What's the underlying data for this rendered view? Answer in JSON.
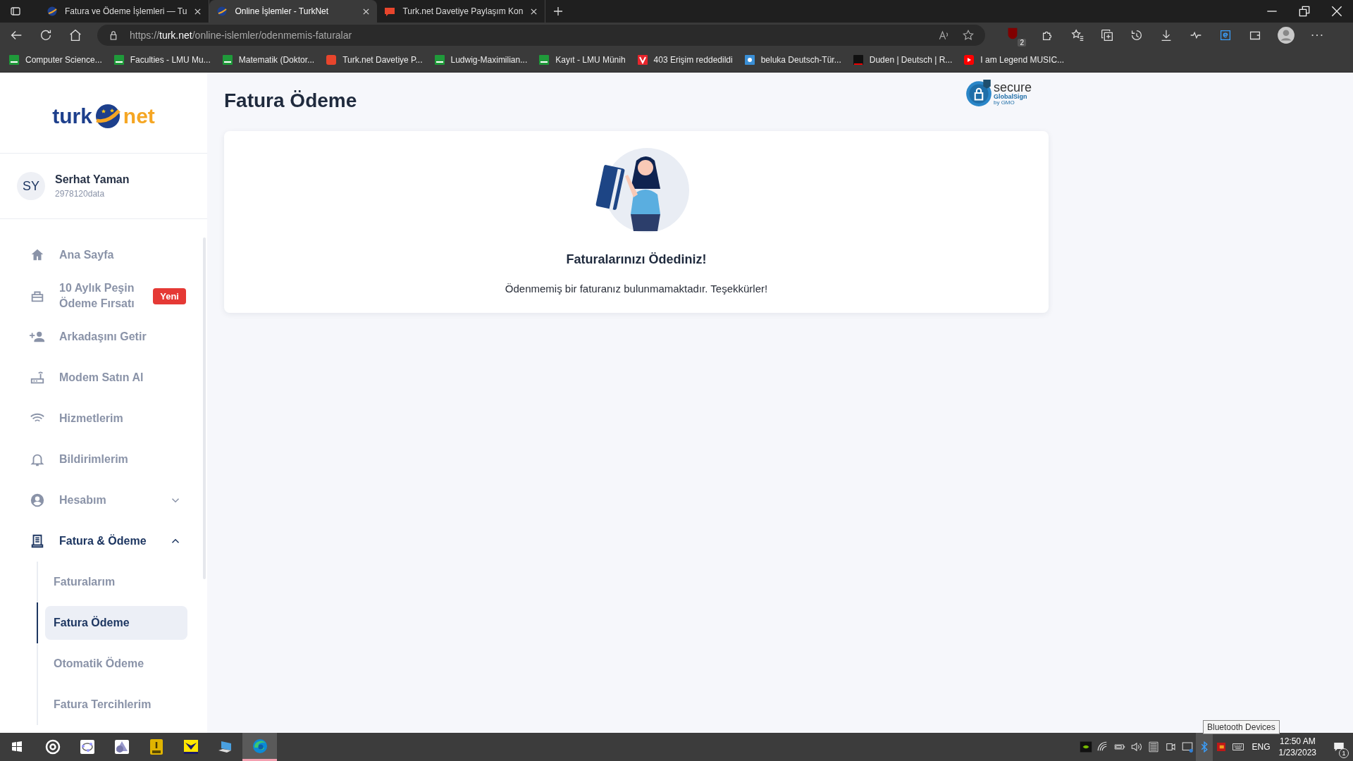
{
  "browser": {
    "tabs": [
      {
        "title": "Fatura ve Ödeme İşlemleri — Tu",
        "kind": "globe",
        "selected": false
      },
      {
        "title": "Online İşlemler - TurkNet",
        "kind": "globe",
        "selected": true
      },
      {
        "title": "Turk.net Davetiye Paylaşım Kon",
        "kind": "dh",
        "selected": false
      }
    ],
    "url": "https://**turk.net**/online-islemler/odenmemis-faturalar",
    "extension_badge": "2",
    "bookmarks": [
      {
        "title": "Computer Science...",
        "kind": "lmu"
      },
      {
        "title": "Faculties - LMU Mu...",
        "kind": "lmu"
      },
      {
        "title": "Matematik (Doktor...",
        "kind": "lmu"
      },
      {
        "title": "Turk.net Davetiye P...",
        "kind": "dh"
      },
      {
        "title": "Ludwig-Maximilian...",
        "kind": "lmu"
      },
      {
        "title": "Kayıt - LMU Münih",
        "kind": "lmu"
      },
      {
        "title": "403 Erişim reddedildi",
        "kind": "v"
      },
      {
        "title": "beluka Deutsch-Tür...",
        "kind": "beluka"
      },
      {
        "title": "Duden | Deutsch | R...",
        "kind": "d"
      },
      {
        "title": "I am Legend MUSIC...",
        "kind": "youtube"
      }
    ]
  },
  "sidebar": {
    "logo": {
      "left": "turk",
      "right": "net"
    },
    "user": {
      "initials": "SY",
      "name": "Serhat Yaman",
      "id": "2978120data"
    },
    "items": [
      {
        "label": "Ana Sayfa",
        "kind": "home",
        "selected": false
      },
      {
        "label": "10 Aylık Peşin Ödeme Fırsatı",
        "kind": "gift",
        "selected": false,
        "badge": "Yeni"
      },
      {
        "label": "Arkadaşını Getir",
        "kind": "person-add",
        "selected": false
      },
      {
        "label": "Modem Satın Al",
        "kind": "router",
        "selected": false
      },
      {
        "label": "Hizmetlerim",
        "kind": "wifi",
        "selected": false
      },
      {
        "label": "Bildirimlerim",
        "kind": "bell",
        "selected": false
      },
      {
        "label": "Hesabım",
        "kind": "account",
        "selected": false,
        "expanded": false
      },
      {
        "label": "Fatura & Ödeme",
        "kind": "invoice",
        "selected": true,
        "expanded": true,
        "children": [
          {
            "label": "Faturalarım",
            "selected": false
          },
          {
            "label": "Fatura Ödeme",
            "selected": true
          },
          {
            "label": "Otomatik Ödeme",
            "selected": false
          },
          {
            "label": "Fatura Tercihlerim",
            "selected": false
          }
        ]
      }
    ]
  },
  "main": {
    "title": "Fatura Ödeme",
    "ssl_seal": {
      "title": "secure",
      "subtitle": "GlobalSign",
      "vendor": "by GMO"
    },
    "card": {
      "heading": "Faturalarınızı Ödediniz!",
      "message": "Ödenmemiş bir faturanız bulunmamaktadır. Teşekkürler!"
    }
  },
  "taskbar": {
    "apps": [
      {
        "kind": "target",
        "selected": false
      },
      {
        "kind": "geogebra",
        "selected": false
      },
      {
        "kind": "triangle",
        "selected": false
      },
      {
        "kind": "pro",
        "selected": false
      },
      {
        "kind": "butterfly",
        "selected": false
      },
      {
        "kind": "laptop",
        "selected": false
      },
      {
        "kind": "edge",
        "selected": true
      }
    ],
    "tray": [
      {
        "kind": "nvidia"
      },
      {
        "kind": "wifi"
      },
      {
        "kind": "battery"
      },
      {
        "kind": "volume"
      },
      {
        "kind": "list"
      },
      {
        "kind": "camera"
      },
      {
        "kind": "display"
      },
      {
        "kind": "bluetooth"
      },
      {
        "kind": "red-app"
      },
      {
        "kind": "keyboard"
      }
    ],
    "language": "ENG",
    "time": "12:50 AM",
    "date": "1/23/2023",
    "notifications": "1",
    "tooltip": "Bluetooth Devices"
  }
}
